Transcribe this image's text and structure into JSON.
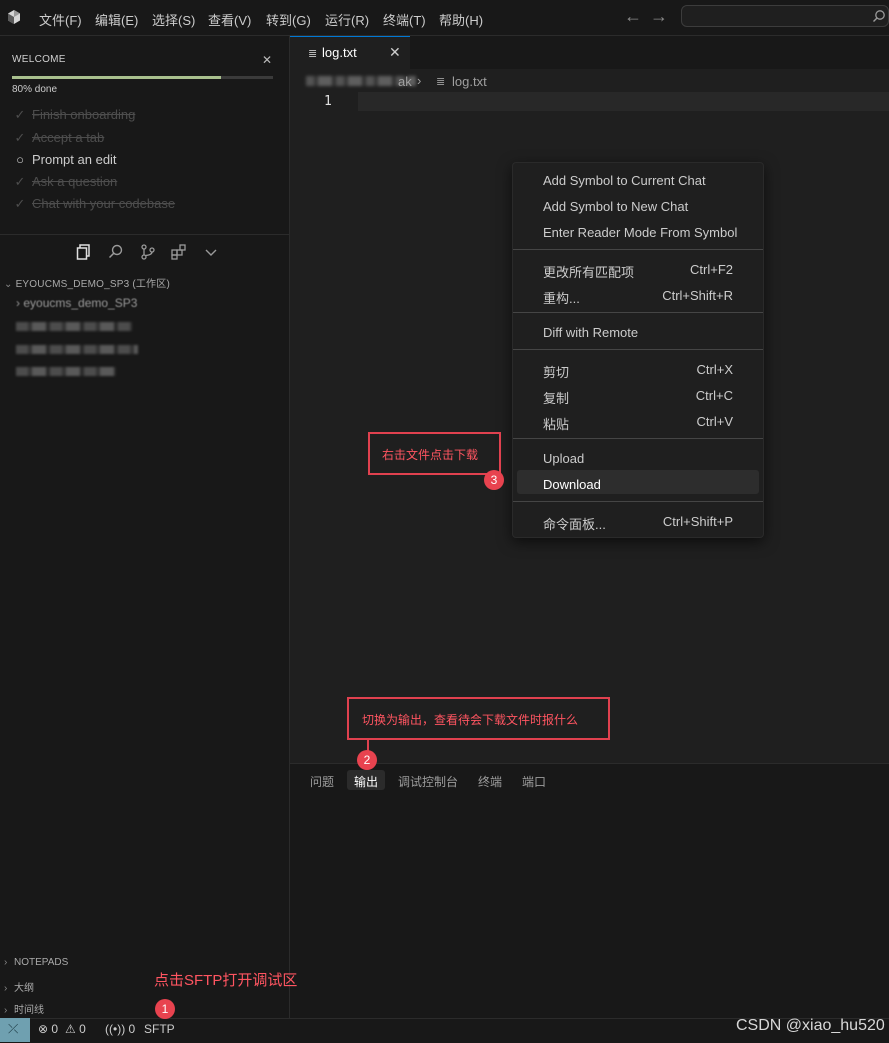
{
  "menubar": {
    "items": [
      "文件(F)",
      "编辑(E)",
      "选择(S)",
      "查看(V)",
      "转到(G)",
      "运行(R)",
      "终端(T)",
      "帮助(H)"
    ]
  },
  "welcome": {
    "title": "WELCOME",
    "progress_label": "80% done",
    "progress_fraction": 0.8,
    "tasks": [
      {
        "label": "Finish onboarding",
        "done": true
      },
      {
        "label": "Accept a tab",
        "done": true
      },
      {
        "label": "Prompt an edit",
        "done": false
      },
      {
        "label": "Ask a question",
        "done": true
      },
      {
        "label": "Chat with your codebase",
        "done": true
      }
    ]
  },
  "explorer": {
    "header": "EYOUCMS_DEMO_SP3 (工作区)",
    "root_folder": "eyoucms_demo_SP3"
  },
  "sidebar_bottom": {
    "notepads": "NOTEPADS",
    "outline": "大纲",
    "timeline": "时间线"
  },
  "editor": {
    "tab_label": "log.txt",
    "breadcrumb_folder": "ak",
    "breadcrumb_file": "log.txt",
    "line_number": "1"
  },
  "context_menu": {
    "group1": [
      {
        "label": "Add Symbol to Current Chat",
        "shortcut": ""
      },
      {
        "label": "Add Symbol to New Chat",
        "shortcut": ""
      },
      {
        "label": "Enter Reader Mode From Symbol",
        "shortcut": ""
      }
    ],
    "group2": [
      {
        "label": "更改所有匹配项",
        "shortcut": "Ctrl+F2"
      },
      {
        "label": "重构...",
        "shortcut": "Ctrl+Shift+R"
      }
    ],
    "group3": [
      {
        "label": "Diff with Remote",
        "shortcut": ""
      }
    ],
    "group4": [
      {
        "label": "剪切",
        "shortcut": "Ctrl+X"
      },
      {
        "label": "复制",
        "shortcut": "Ctrl+C"
      },
      {
        "label": "粘贴",
        "shortcut": "Ctrl+V"
      }
    ],
    "group5": [
      {
        "label": "Upload",
        "shortcut": ""
      },
      {
        "label": "Download",
        "shortcut": ""
      }
    ],
    "group6": [
      {
        "label": "命令面板...",
        "shortcut": "Ctrl+Shift+P"
      }
    ]
  },
  "annotations": {
    "step1_text": "点击SFTP打开调试区",
    "step1_badge": "1",
    "step2_text": "切换为输出，查看待会下载文件时报什么",
    "step2_badge": "2",
    "step3_text": "右击文件点击下载",
    "step3_badge": "3",
    "color": "#e0414f"
  },
  "panel": {
    "tabs": [
      "问题",
      "输出",
      "调试控制台",
      "终端",
      "端口"
    ],
    "active_tab": "输出"
  },
  "statusbar": {
    "errors": "0",
    "warnings": "0",
    "ports": "0",
    "sftp_label": "SFTP"
  },
  "watermark": "CSDN @xiao_hu520",
  "colors": {
    "accent": "#0078d4",
    "progress": "#a9c08e",
    "remote": "#6fa0b0"
  }
}
